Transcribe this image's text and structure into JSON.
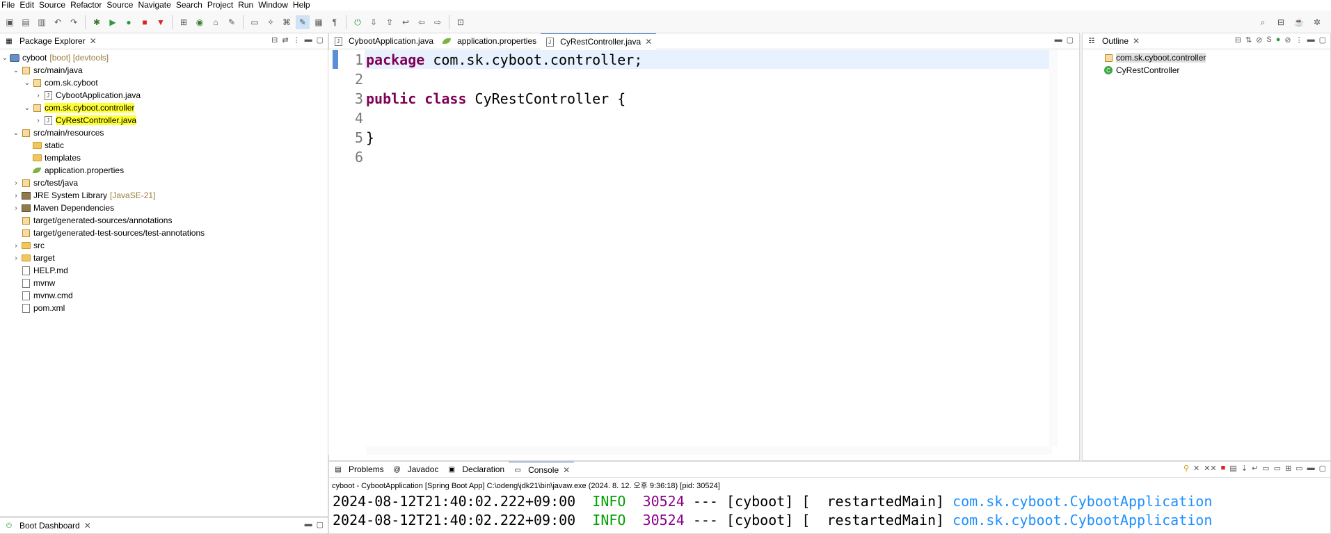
{
  "menu": [
    "File",
    "Edit",
    "Source",
    "Refactor",
    "Source",
    "Navigate",
    "Search",
    "Project",
    "Run",
    "Window",
    "Help"
  ],
  "package_explorer": {
    "title": "Package Explorer",
    "tree": [
      {
        "indent": 0,
        "twisty": "v",
        "icon": "project",
        "label": "cyboot",
        "deco": "[boot] [devtools]",
        "hl": false
      },
      {
        "indent": 1,
        "twisty": "v",
        "icon": "srcfolder",
        "label": "src/main/java",
        "deco": "",
        "hl": false
      },
      {
        "indent": 2,
        "twisty": "v",
        "icon": "package",
        "label": "com.sk.cyboot",
        "deco": "",
        "hl": false
      },
      {
        "indent": 3,
        "twisty": ">",
        "icon": "java",
        "label": "CybootApplication.java",
        "deco": "",
        "hl": false
      },
      {
        "indent": 2,
        "twisty": "v",
        "icon": "package",
        "label": "com.sk.cyboot.controller",
        "deco": "",
        "hl": true
      },
      {
        "indent": 3,
        "twisty": ">",
        "icon": "java",
        "label": "CyRestController.java",
        "deco": "",
        "hl": true
      },
      {
        "indent": 1,
        "twisty": "v",
        "icon": "srcfolder",
        "label": "src/main/resources",
        "deco": "",
        "hl": false
      },
      {
        "indent": 2,
        "twisty": "",
        "icon": "folder",
        "label": "static",
        "deco": "",
        "hl": false
      },
      {
        "indent": 2,
        "twisty": "",
        "icon": "folder",
        "label": "templates",
        "deco": "",
        "hl": false
      },
      {
        "indent": 2,
        "twisty": "",
        "icon": "leaf",
        "label": "application.properties",
        "deco": "",
        "hl": false
      },
      {
        "indent": 1,
        "twisty": ">",
        "icon": "srcfolder",
        "label": "src/test/java",
        "deco": "",
        "hl": false
      },
      {
        "indent": 1,
        "twisty": ">",
        "icon": "jar",
        "label": "JRE System Library",
        "deco": "[JavaSE-21]",
        "hl": false
      },
      {
        "indent": 1,
        "twisty": ">",
        "icon": "jar",
        "label": "Maven Dependencies",
        "deco": "",
        "hl": false
      },
      {
        "indent": 1,
        "twisty": "",
        "icon": "srcfolder",
        "label": "target/generated-sources/annotations",
        "deco": "",
        "hl": false
      },
      {
        "indent": 1,
        "twisty": "",
        "icon": "srcfolder",
        "label": "target/generated-test-sources/test-annotations",
        "deco": "",
        "hl": false
      },
      {
        "indent": 1,
        "twisty": ">",
        "icon": "folder",
        "label": "src",
        "deco": "",
        "hl": false
      },
      {
        "indent": 1,
        "twisty": ">",
        "icon": "folder",
        "label": "target",
        "deco": "",
        "hl": false
      },
      {
        "indent": 1,
        "twisty": "",
        "icon": "md",
        "label": "HELP.md",
        "deco": "",
        "hl": false
      },
      {
        "indent": 1,
        "twisty": "",
        "icon": "md",
        "label": "mvnw",
        "deco": "",
        "hl": false
      },
      {
        "indent": 1,
        "twisty": "",
        "icon": "md",
        "label": "mvnw.cmd",
        "deco": "",
        "hl": false
      },
      {
        "indent": 1,
        "twisty": "",
        "icon": "md",
        "label": "pom.xml",
        "deco": "",
        "hl": false
      }
    ]
  },
  "boot_dashboard": {
    "title": "Boot Dashboard"
  },
  "editor": {
    "tabs": [
      {
        "label": "CybootApplication.java",
        "active": false
      },
      {
        "label": "application.properties",
        "active": false
      },
      {
        "label": "CyRestController.java",
        "active": true
      }
    ],
    "lines": [
      {
        "no": "1",
        "kw": "package",
        "rest": " com.sk.cyboot.controller;"
      },
      {
        "no": "2",
        "kw": "",
        "rest": ""
      },
      {
        "no": "3",
        "kw": "public class",
        "rest": " CyRestController {"
      },
      {
        "no": "4",
        "kw": "",
        "rest": ""
      },
      {
        "no": "5",
        "kw": "",
        "rest": "}"
      },
      {
        "no": "6",
        "kw": "",
        "rest": ""
      }
    ]
  },
  "outline": {
    "title": "Outline",
    "items": [
      {
        "label": "com.sk.cyboot.controller",
        "selected": true
      },
      {
        "label": "CyRestController",
        "selected": false
      }
    ]
  },
  "bottom": {
    "tabs": [
      "Problems",
      "Javadoc",
      "Declaration",
      "Console"
    ],
    "active_tab": "Console",
    "console_header": "cyboot - CybootApplication [Spring Boot App] C:\\odeng\\jdk21\\bin\\javaw.exe  (2024. 8. 12. 오후 9:36:18) [pid: 30524]",
    "log_lines": [
      {
        "ts": "2024-08-12T21:40:02.222+09:00",
        "level": "INFO",
        "pid": "30524",
        "mid": " --- [cyboot] [  restartedMain] ",
        "cls": "com.sk.cyboot.CybootApplication"
      },
      {
        "ts": "2024-08-12T21:40:02.222+09:00",
        "level": "INFO",
        "pid": "30524",
        "mid": " --- [cyboot] [  restartedMain] ",
        "cls": "com.sk.cyboot.CybootApplication"
      }
    ]
  }
}
